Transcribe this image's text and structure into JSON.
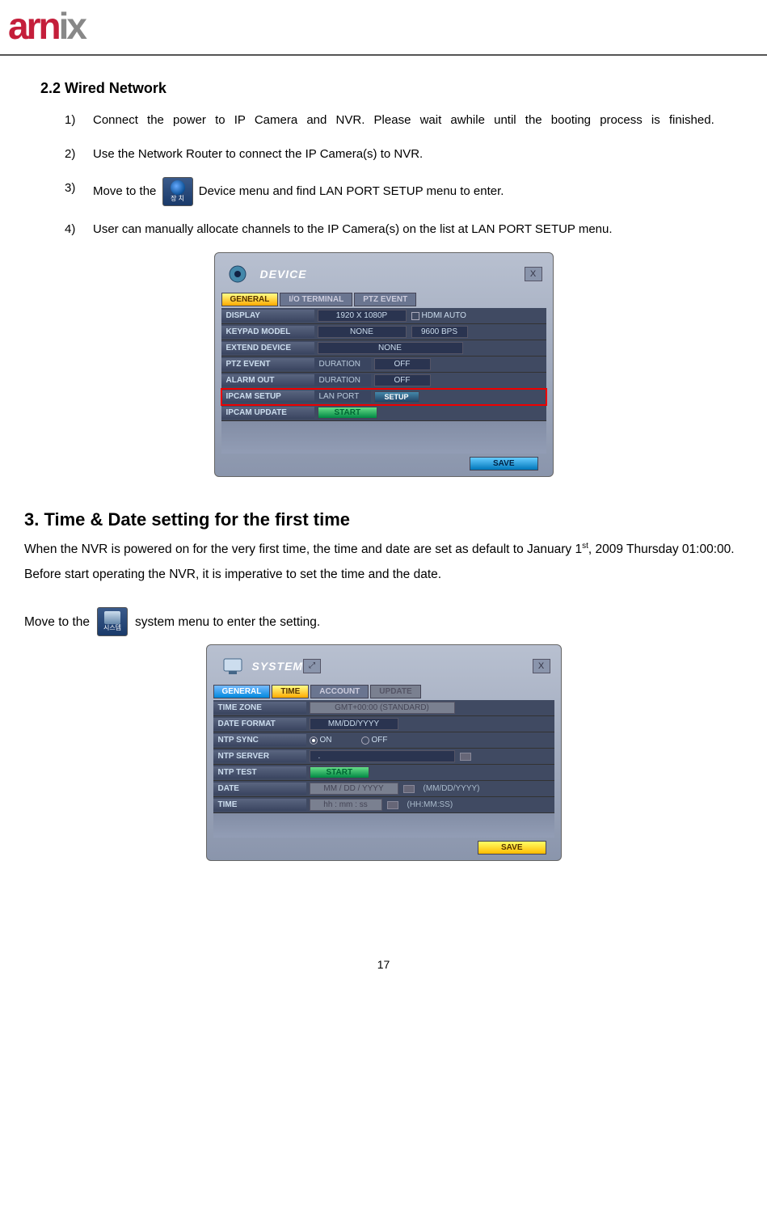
{
  "logo": {
    "left": "arn",
    "right": "ix"
  },
  "section_sub": "2.2  Wired Network",
  "steps": [
    {
      "num": "1)",
      "text": "Connect the power to IP Camera and NVR.  Please wait awhile until the booting process is finished."
    },
    {
      "num": "2)",
      "text": "Use the Network Router to connect the IP Camera(s) to NVR."
    },
    {
      "num": "3)",
      "pre": "Move to the",
      "post": "  Device menu and find LAN PORT SETUP menu to enter."
    },
    {
      "num": "4)",
      "text": "User can manually allocate channels to the IP Camera(s) on the list at LAN PORT SETUP menu."
    }
  ],
  "dlg1": {
    "title": "DEVICE",
    "tabs": [
      "GENERAL",
      "I/O TERMINAL",
      "PTZ EVENT"
    ],
    "rows": {
      "display": {
        "label": "DISPLAY",
        "val": "1920 X 1080P",
        "chk": "HDMI AUTO"
      },
      "keypad": {
        "label": "KEYPAD MODEL",
        "val": "NONE",
        "bps": "9600 BPS"
      },
      "extend": {
        "label": "EXTEND DEVICE",
        "val": "NONE"
      },
      "ptz": {
        "label": "PTZ EVENT",
        "sub": "DURATION",
        "val": "OFF"
      },
      "alarm": {
        "label": "ALARM OUT",
        "sub": "DURATION",
        "val": "OFF"
      },
      "ipcam": {
        "label": "IPCAM SETUP",
        "sub": "LAN PORT",
        "btn": "SETUP"
      },
      "update": {
        "label": "IPCAM UPDATE",
        "btn": "START"
      }
    },
    "save": "SAVE"
  },
  "h_main": "3. Time & Date setting for the first time",
  "body1_a": "When the NVR is powered on for the very first time, the time and date are set as default to January 1",
  "body1_sup": "st",
  "body1_b": ", 2009 Thursday 01:00:00.   Before start operating the NVR, it is imperative to set the time and the date.",
  "move_pre": "Move to the",
  "move_post": " system menu to enter the setting.",
  "dlg2": {
    "title": "SYSTEM",
    "tabs": [
      "GENERAL",
      "TIME",
      "ACCOUNT",
      "UPDATE"
    ],
    "rows": {
      "tz": {
        "label": "TIME ZONE",
        "val": "GMT+00:00 (STANDARD)"
      },
      "df": {
        "label": "DATE FORMAT",
        "val": "MM/DD/YYYY"
      },
      "ntp": {
        "label": "NTP SYNC",
        "on": "ON",
        "off": "OFF"
      },
      "ntps": {
        "label": "NTP SERVER",
        "val": "."
      },
      "ntpt": {
        "label": "NTP TEST",
        "btn": "START"
      },
      "date": {
        "label": "DATE",
        "val": "MM / DD / YYYY",
        "hint": "(MM/DD/YYYY)"
      },
      "time": {
        "label": "TIME",
        "val": "hh : mm : ss",
        "hint": "(HH:MM:SS)"
      }
    },
    "save": "SAVE"
  },
  "page_num": "17"
}
